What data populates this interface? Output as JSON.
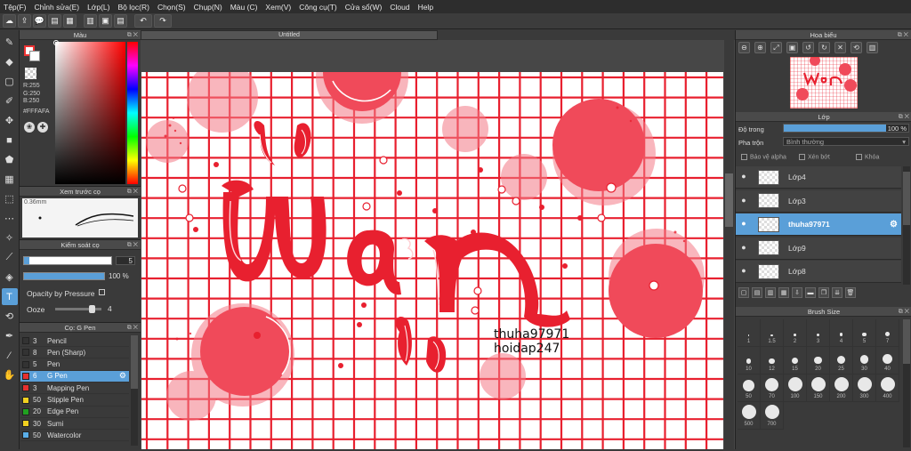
{
  "menu": [
    "Tệp(F)",
    "Chỉnh sửa(E)",
    "Lớp(L)",
    "Bộ lọc(R)",
    "Chọn(S)",
    "Chụp(N)",
    "Màu (C)",
    "Xem(V)",
    "Công cụ(T)",
    "Cửa sổ(W)",
    "Cloud",
    "Help"
  ],
  "toolbar": {
    "icons": [
      "cloud-icon",
      "export-icon",
      "chat-icon",
      "comment-icon",
      "layer-icon",
      "panel-icon",
      "grid-icon",
      "list-icon",
      "undo-icon",
      "redo-icon"
    ],
    "glyphs": [
      "☁",
      "⇪",
      "💬",
      "▤",
      "▦",
      "▥",
      "▣",
      "▤",
      "↶",
      "↷"
    ]
  },
  "tools": {
    "glyphs": [
      "✎",
      "◆",
      "▢",
      "✐",
      "✥",
      "■",
      "⬟",
      "▦",
      "⬚",
      "⋯",
      "✧",
      "⟋",
      "◈",
      "T",
      "⟲",
      "✒",
      "⁄",
      "✋"
    ]
  },
  "color_panel": {
    "title": "Màu",
    "r": "R:255",
    "g": "G:250",
    "b": "B:250",
    "hex": "#FFFAFA"
  },
  "preview_panel": {
    "title": "Xem trước cọ",
    "size": "0.36mm"
  },
  "control_panel": {
    "title": "Kiểm soát cọ",
    "size_value": "5",
    "opacity_value": "100 %",
    "opacity_pressure": "Opacity by Pressure",
    "ooze_label": "Ooze",
    "ooze_value": "4"
  },
  "brush_panel": {
    "title": "Cọ: G Pen",
    "brushes": [
      {
        "size": "3",
        "name": "Pencil",
        "color": "#333333"
      },
      {
        "size": "8",
        "name": "Pen (Sharp)",
        "color": "#333333"
      },
      {
        "size": "5",
        "name": "Pen",
        "color": "#333333"
      },
      {
        "size": "6",
        "name": "G Pen",
        "color": "#e53030",
        "selected": true
      },
      {
        "size": "3",
        "name": "Mapping Pen",
        "color": "#e53030"
      },
      {
        "size": "50",
        "name": "Stipple Pen",
        "color": "#f0d020"
      },
      {
        "size": "20",
        "name": "Edge Pen",
        "color": "#20a020"
      },
      {
        "size": "30",
        "name": "Sumi",
        "color": "#f0d020"
      },
      {
        "size": "50",
        "name": "Watercolor",
        "color": "#5aaee8"
      }
    ]
  },
  "document": {
    "tab": "Untitled",
    "canvas_text": [
      "thuha97971",
      "hoidap247"
    ],
    "art_word": "war"
  },
  "navigator": {
    "title": "Hoa biểu"
  },
  "layer_panel": {
    "title": "Lớp",
    "opacity_label": "Độ trong",
    "opacity_value": "100 %",
    "blend_label": "Pha trộn",
    "blend_value": "Bình thường",
    "protect_alpha": "Bảo vệ alpha",
    "clipping": "Xén bớt",
    "lock": "Khóa",
    "layers": [
      {
        "name": "Lớp4"
      },
      {
        "name": "Lớp3"
      },
      {
        "name": "thuha97971",
        "selected": true
      },
      {
        "name": "Lớp9"
      },
      {
        "name": "Lớp8"
      }
    ]
  },
  "brush_size_panel": {
    "title": "Brush Size",
    "sizes": [
      "1",
      "1.5",
      "2",
      "3",
      "4",
      "5",
      "7",
      "10",
      "12",
      "15",
      "20",
      "25",
      "30",
      "40",
      "50",
      "70",
      "100",
      "150",
      "200",
      "300",
      "400",
      "500",
      "700"
    ]
  },
  "colors": {
    "accent": "#5a9fd8",
    "art_red": "#e8202f",
    "art_pink": "#f04a5a"
  }
}
